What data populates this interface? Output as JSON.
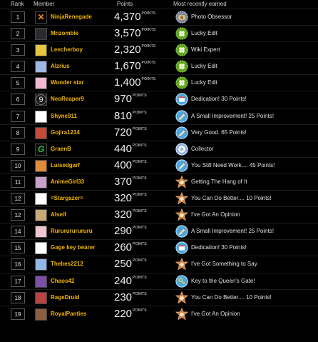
{
  "header": {
    "rank": "Rank",
    "member": "Member",
    "points": "Points",
    "recent": "Most recently earned"
  },
  "points_label": "POINTS",
  "rows": [
    {
      "rank": "1",
      "member": "NinjaRenegade",
      "points": "4,370",
      "badge": "Photo Obsessor",
      "badge_icon": "photo-badge-icon",
      "avatar": "ninja-logo"
    },
    {
      "rank": "2",
      "member": "Mnzombie",
      "points": "3,570",
      "badge": "Lucky Edit",
      "badge_icon": "clover-badge-icon",
      "avatar": "dark-figure"
    },
    {
      "rank": "3",
      "member": "Leecherboy",
      "points": "2,320",
      "badge": "Wiki Expert",
      "badge_icon": "clover-badge-icon",
      "avatar": "yellow-face"
    },
    {
      "rank": "4",
      "member": "Alzrius",
      "points": "1,670",
      "badge": "Lucky Edit",
      "badge_icon": "clover-badge-icon",
      "avatar": "blue-figure"
    },
    {
      "rank": "5",
      "member": "Wonder star",
      "points": "1,400",
      "badge": "Lucky Edit",
      "badge_icon": "clover-badge-icon",
      "avatar": "pink-figure"
    },
    {
      "rank": "6",
      "member": "NeoReaper9",
      "points": "970",
      "badge": "Dedication! 30 Points!",
      "badge_icon": "calendar-badge-icon",
      "avatar": "number-nine"
    },
    {
      "rank": "7",
      "member": "Shyne911",
      "points": "810",
      "badge": "A Small Improvement! 25 Points!",
      "badge_icon": "pencil-badge-icon",
      "avatar": "blank"
    },
    {
      "rank": "8",
      "member": "Gojira1234",
      "points": "720",
      "badge": "Very Good. 65 Points!",
      "badge_icon": "pencil-badge-icon",
      "avatar": "red-figure"
    },
    {
      "rank": "9",
      "member": "GraenB",
      "points": "440",
      "badge": "Collector",
      "badge_icon": "collector-badge-icon",
      "avatar": "green-g"
    },
    {
      "rank": "10",
      "member": "Luisedgarf",
      "points": "400",
      "badge": "You Still Need Work.... 45 Points!",
      "badge_icon": "pencil-badge-icon",
      "avatar": "orange-figure"
    },
    {
      "rank": "11",
      "member": "AnimeGirl33",
      "points": "370",
      "badge": "Getting The Hang of It",
      "badge_icon": "star-badge-icon",
      "avatar": "anime-girl"
    },
    {
      "rank": "12",
      "member": "=Stargazer=",
      "points": "320",
      "badge": "You Can Do Better.... 10 Points!",
      "badge_icon": "star-badge-icon",
      "avatar": "blank"
    },
    {
      "rank": "12",
      "member": "Alseif",
      "points": "320",
      "badge": "I've Got An Opinion",
      "badge_icon": "star-badge-icon",
      "avatar": "tan-figure"
    },
    {
      "rank": "14",
      "member": "Rururururururu",
      "points": "290",
      "badge": "A Small Improvement! 25 Points!",
      "badge_icon": "pencil-badge-icon",
      "avatar": "pink-face"
    },
    {
      "rank": "15",
      "member": "Gage key bearer",
      "points": "260",
      "badge": "Dedication! 30 Points!",
      "badge_icon": "calendar-badge-icon",
      "avatar": "blank"
    },
    {
      "rank": "16",
      "member": "Thebes2212",
      "points": "250",
      "badge": "I've Got Something to Say",
      "badge_icon": "star-badge-icon",
      "avatar": "blue-lines"
    },
    {
      "rank": "17",
      "member": "Chaos42",
      "points": "240",
      "badge": "Key to the Queen's Gate!",
      "badge_icon": "key-badge-icon",
      "avatar": "purple-figure"
    },
    {
      "rank": "18",
      "member": "RageDruid",
      "points": "230",
      "badge": "You Can Do Better.... 10 Points!",
      "badge_icon": "star-badge-icon",
      "avatar": "red-creature"
    },
    {
      "rank": "19",
      "member": "RoyalPanties",
      "points": "220",
      "badge": "I've Got An Opinion",
      "badge_icon": "star-badge-icon",
      "avatar": "brown-figure"
    }
  ],
  "colors": {
    "background": "#000000",
    "member_name": "#f1b500",
    "text": "#ededed",
    "rank_border": "#5a5a5a"
  }
}
